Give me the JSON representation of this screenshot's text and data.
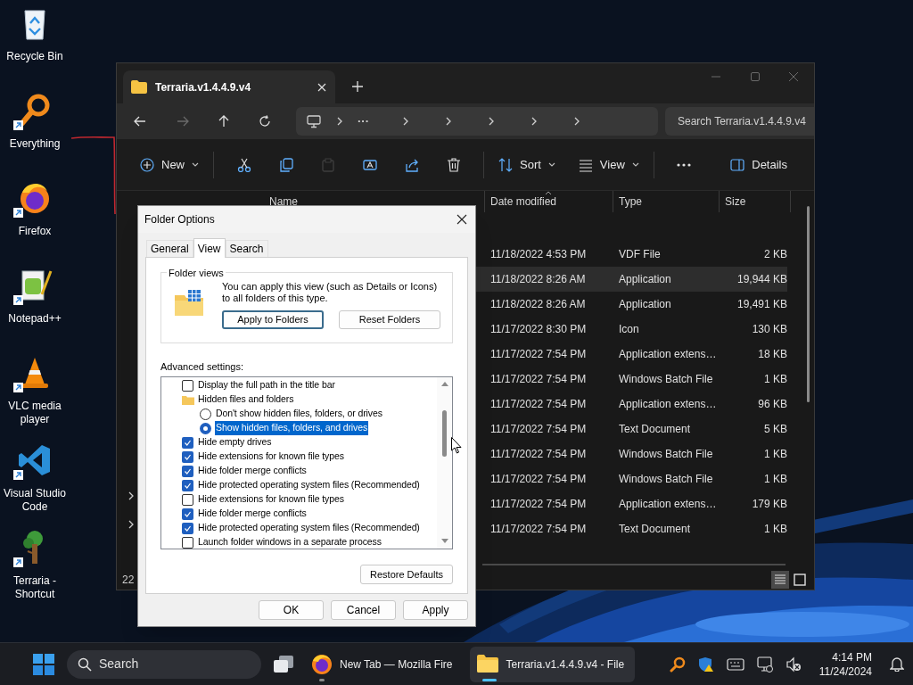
{
  "desktop_icons": [
    {
      "kind": "recycle-bin",
      "label": "Recycle Bin",
      "shortcut": false
    },
    {
      "kind": "magnifier",
      "label": "Everything",
      "shortcut": true
    },
    {
      "kind": "firefox",
      "label": "Firefox",
      "shortcut": true
    },
    {
      "kind": "notepad",
      "label": "Notepad++",
      "shortcut": true
    },
    {
      "kind": "cone",
      "label": "VLC media player",
      "shortcut": true
    },
    {
      "kind": "vscode",
      "label": "Visual Studio Code",
      "shortcut": true
    },
    {
      "kind": "tree",
      "label": "Terraria - Shortcut",
      "shortcut": true
    }
  ],
  "explorer": {
    "tab_title": "Terraria.v1.4.4.9.v4",
    "address_ellipsis": "···",
    "search_placeholder": "Search Terraria.v1.4.4.9.v4",
    "toolbar": [
      {
        "kind": "new",
        "label": "New",
        "disabled": false
      },
      {
        "kind": "separator"
      },
      {
        "kind": "cut",
        "disabled": false
      },
      {
        "kind": "copy",
        "disabled": false
      },
      {
        "kind": "paste",
        "disabled": true
      },
      {
        "kind": "rename",
        "disabled": false
      },
      {
        "kind": "share",
        "disabled": false
      },
      {
        "kind": "delete",
        "disabled": false
      },
      {
        "kind": "separator"
      },
      {
        "kind": "sort",
        "label": "Sort",
        "disabled": false
      },
      {
        "kind": "view",
        "label": "View",
        "disabled": false
      },
      {
        "kind": "separator"
      },
      {
        "kind": "more",
        "disabled": false
      },
      {
        "kind": "details",
        "label": "Details",
        "disabled": false
      }
    ],
    "columns": [
      "Name",
      "Date modified",
      "Type",
      "Size"
    ],
    "rows": [
      {
        "date": "11/18/2022 4:53 PM",
        "type": "VDF File",
        "size": "2 KB",
        "selected": false
      },
      {
        "date": "11/18/2022 8:26 AM",
        "type": "Application",
        "size": "19,944 KB",
        "selected": true
      },
      {
        "date": "11/18/2022 8:26 AM",
        "type": "Application",
        "size": "19,491 KB",
        "selected": false
      },
      {
        "date": "11/17/2022 8:30 PM",
        "type": "Icon",
        "size": "130 KB",
        "selected": false
      },
      {
        "date": "11/17/2022 7:54 PM",
        "type": "Application extens…",
        "size": "18 KB",
        "selected": false
      },
      {
        "date": "11/17/2022 7:54 PM",
        "type": "Windows Batch File",
        "size": "1 KB",
        "selected": false
      },
      {
        "date": "11/17/2022 7:54 PM",
        "type": "Application extens…",
        "size": "96 KB",
        "selected": false
      },
      {
        "date": "11/17/2022 7:54 PM",
        "type": "Text Document",
        "size": "5 KB",
        "selected": false
      },
      {
        "date": "11/17/2022 7:54 PM",
        "type": "Windows Batch File",
        "size": "1 KB",
        "selected": false
      },
      {
        "date": "11/17/2022 7:54 PM",
        "type": "Windows Batch File",
        "size": "1 KB",
        "selected": false
      },
      {
        "date": "11/17/2022 7:54 PM",
        "type": "Application extens…",
        "size": "179 KB",
        "selected": false
      },
      {
        "date": "11/17/2022 7:54 PM",
        "type": "Text Document",
        "size": "1 KB",
        "selected": false
      }
    ],
    "status": "22",
    "view_modes": [
      {
        "kind": "details",
        "selected": true
      },
      {
        "kind": "tiles",
        "selected": false
      }
    ]
  },
  "dialog": {
    "title": "Folder Options",
    "tabs": [
      {
        "label": "General",
        "selected": false
      },
      {
        "label": "View",
        "selected": true
      },
      {
        "label": "Search",
        "selected": false
      }
    ],
    "folder_views": {
      "legend": "Folder views",
      "description": "You can apply this view (such as Details or Icons) to all folders of this type.",
      "buttons": [
        {
          "label": "Apply to Folders",
          "focused": true
        },
        {
          "label": "Reset Folders",
          "focused": false
        }
      ]
    },
    "advanced_label": "Advanced settings:",
    "settings": [
      {
        "kind": "checkbox",
        "label": "Display the full path in the title bar",
        "checked": false
      },
      {
        "kind": "folder",
        "label": "Hidden files and folders",
        "children": [
          {
            "kind": "radio",
            "label": "Don't show hidden files, folders, or drives",
            "checked": false,
            "selected": false
          },
          {
            "kind": "radio",
            "label": "Show hidden files, folders, and drives",
            "checked": true,
            "selected": true
          }
        ]
      },
      {
        "kind": "checkbox",
        "label": "Hide empty drives",
        "checked": true
      },
      {
        "kind": "checkbox",
        "label": "Hide extensions for known file types",
        "checked": true
      },
      {
        "kind": "checkbox",
        "label": "Hide folder merge conflicts",
        "checked": true
      },
      {
        "kind": "checkbox",
        "label": "Hide protected operating system files (Recommended)",
        "checked": true
      },
      {
        "kind": "checkbox",
        "label": "Hide extensions for known file types",
        "checked": false
      },
      {
        "kind": "checkbox",
        "label": "Hide folder merge conflicts",
        "checked": true
      },
      {
        "kind": "checkbox",
        "label": "Hide protected operating system files (Recommended)",
        "checked": true
      },
      {
        "kind": "checkbox",
        "label": "Launch folder windows in a separate process",
        "checked": false
      }
    ],
    "restore_button": "Restore Defaults",
    "buttons": [
      "OK",
      "Cancel",
      "Apply"
    ]
  },
  "taskbar": {
    "search_placeholder": "Search",
    "apps": [
      {
        "kind": "firefox",
        "label": "New Tab — Mozilla Fire",
        "active": false
      },
      {
        "kind": "folder",
        "label": "Terraria.v1.4.4.9.v4 - File",
        "active": true
      }
    ],
    "clock": {
      "time": "4:14 PM",
      "date": "11/24/2024"
    }
  }
}
